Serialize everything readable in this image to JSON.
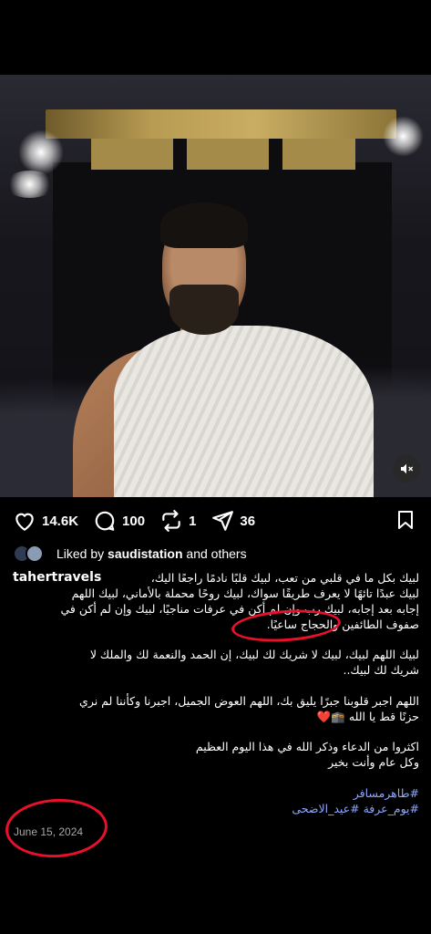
{
  "post": {
    "sound_icon": "speaker-off-icon"
  },
  "actions": {
    "likes": "14.6K",
    "comments": "100",
    "reposts": "1",
    "shares": "36"
  },
  "liked_by": {
    "prefix": "Liked by",
    "user": "saudistation",
    "suffix": "and others"
  },
  "caption": {
    "username": "tahertravels",
    "p1_line1": "لبيك بكل ما في قلبي من تعب، لبيك قلبًا نادمًا راجعًا اليك،",
    "p1_line2": "لبيك عبدًا تائهًا لا يعرف طريقًا سواك، لبيك روحًا محملة بالأماني، لبيك اللهم",
    "p1_line3": "إجابه بعد إجابه، لبيك رب وإن لم أكن في عرفات مناجيًا، لبيك وإن لم أكن في",
    "p1_line4": "صفوف الطائفين والحجاج ساعيًا.",
    "p2_line1": "لبيك اللهم لبيك، لبيك لا شريك لك لبيك، إن الحمد والنعمة لك والملك لا",
    "p2_line2": "شريك لك لبيك..",
    "p3_line1": "اللهم اجبر قلوبنا جبرًا يليق بك، اللهم العوض الجميل، اجبرنا وكأننا لم نري",
    "p3_line2": "حزنًا قط يا الله",
    "p3_emoji": "🕋❤️",
    "p4_line1": "اكثروا من الدعاء وذكر الله في هذا اليوم العظيم",
    "p4_line2": "وكل عام وأنت بخير",
    "hashtag1": "#طاهرمسافر",
    "hashtag2": "#يوم_عرفة #عيد_الاضحى"
  },
  "date": "June 15, 2024",
  "colors": {
    "background": "#000000",
    "hashtag": "#8fa7ff",
    "annotation": "#e8102a",
    "muted": "#a8a8a8"
  }
}
